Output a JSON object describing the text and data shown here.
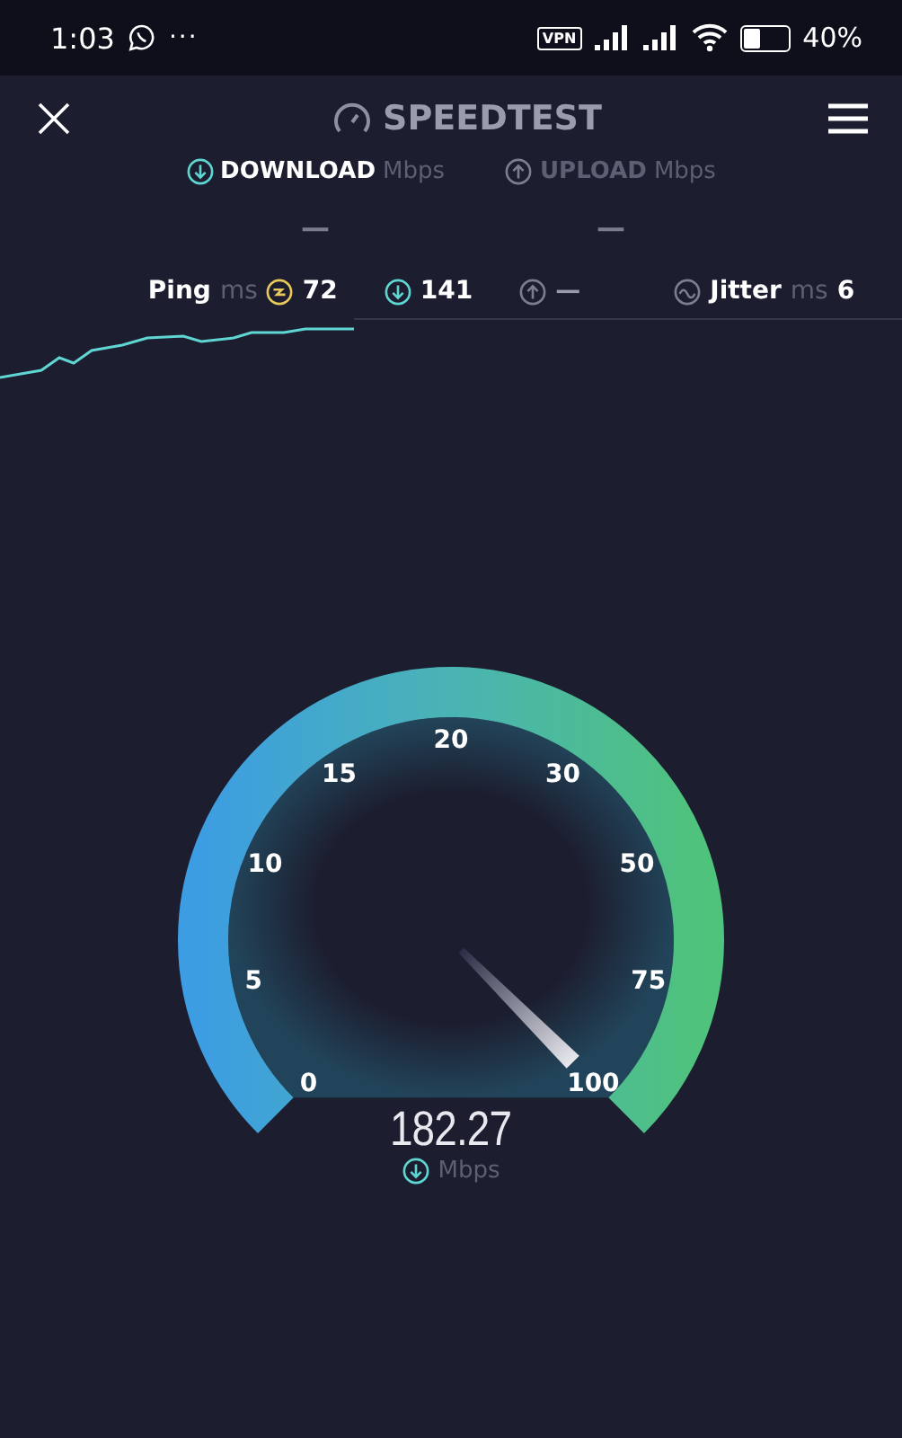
{
  "status_bar": {
    "time": "1:03",
    "more": "···",
    "vpn": "VPN",
    "battery": "40%"
  },
  "header": {
    "title": "SPEEDTEST"
  },
  "tabs": [
    {
      "kind": "download",
      "label": "DOWNLOAD",
      "unit": "Mbps",
      "value": "—",
      "selected": true
    },
    {
      "kind": "upload",
      "label": "UPLOAD",
      "unit": "Mbps",
      "value": "—",
      "selected": false
    }
  ],
  "stats": [
    {
      "kind": "ping",
      "label": "Ping",
      "unit": "ms",
      "value": "72"
    },
    {
      "kind": "download",
      "value": "141"
    },
    {
      "kind": "upload",
      "value": "—"
    },
    {
      "kind": "jitter",
      "label": "Jitter",
      "unit": "ms",
      "value": "6"
    }
  ],
  "gauge": {
    "ticks": [
      "0",
      "5",
      "10",
      "15",
      "20",
      "30",
      "50",
      "75",
      "100"
    ],
    "reading": "182.27",
    "unit": "Mbps"
  }
}
